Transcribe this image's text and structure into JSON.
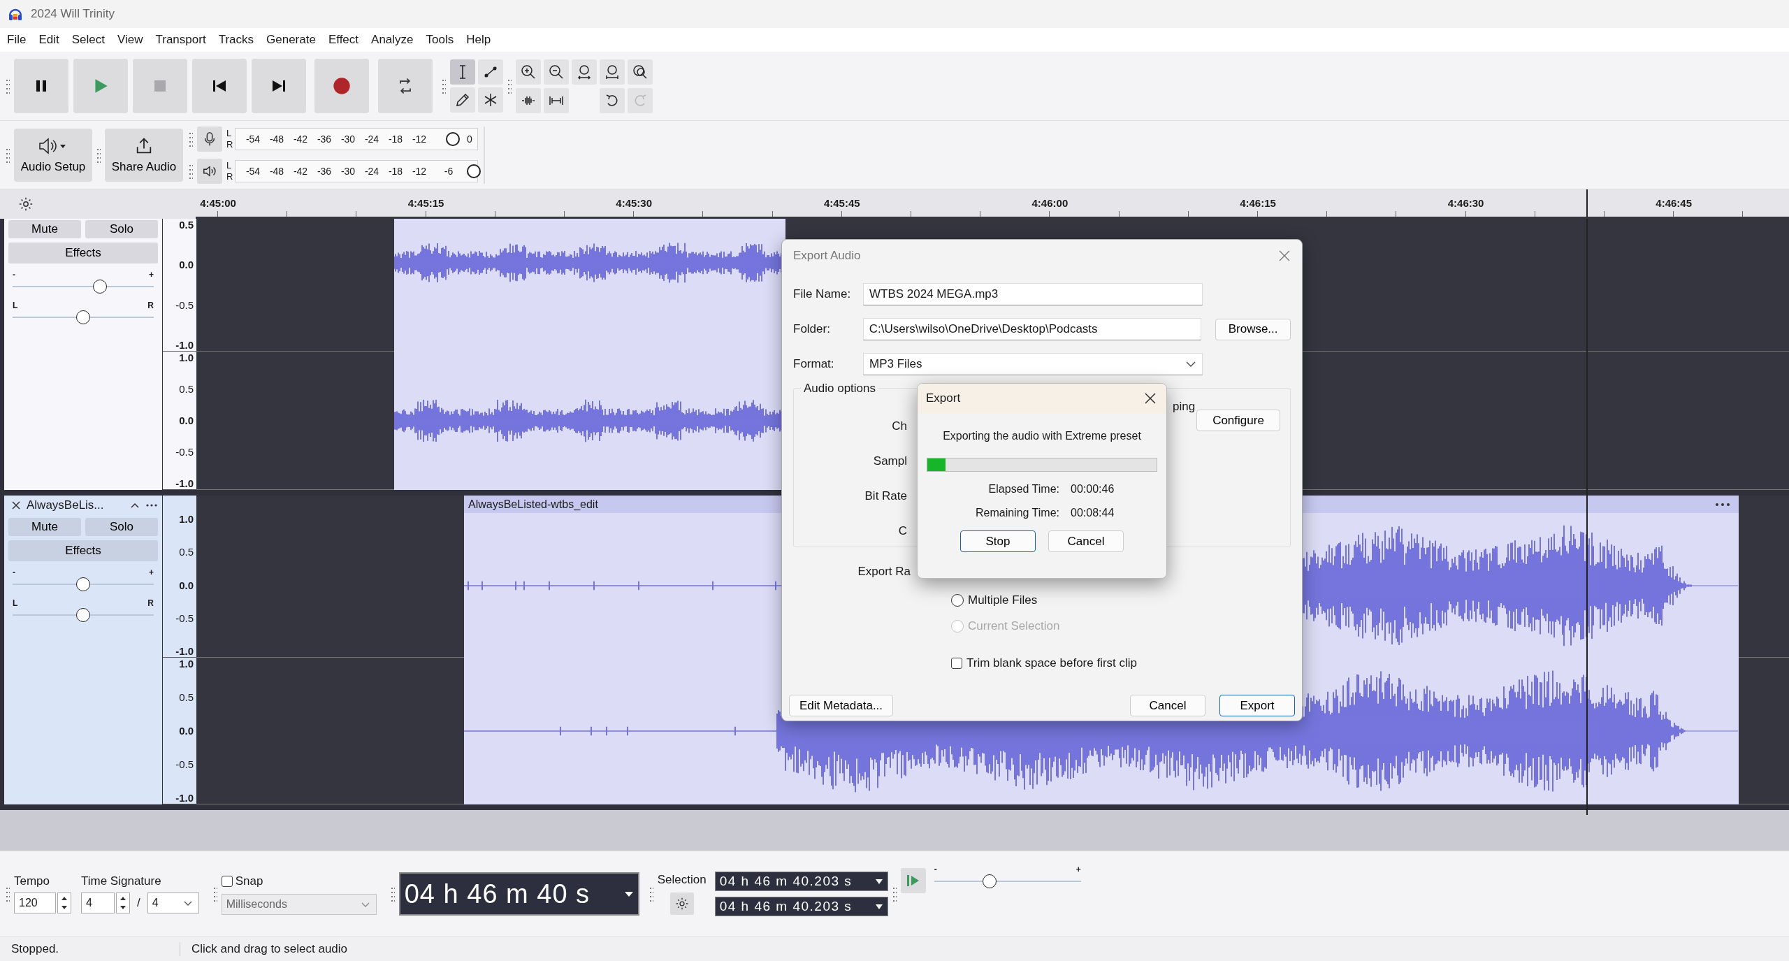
{
  "window": {
    "title": "2024 Will Trinity"
  },
  "menu": [
    "File",
    "Edit",
    "Select",
    "View",
    "Transport",
    "Tracks",
    "Generate",
    "Effect",
    "Analyze",
    "Tools",
    "Help"
  ],
  "tools": [
    {
      "kind": "select",
      "selected": true
    },
    {
      "kind": "envelope",
      "selected": false
    },
    {
      "kind": "draw",
      "selected": false
    },
    {
      "kind": "multi",
      "selected": false
    }
  ],
  "toolbar": {
    "audio_setup": "Audio Setup",
    "share_audio": "Share Audio"
  },
  "meters": [
    {
      "kind": "record",
      "channels": [
        "L",
        "R"
      ],
      "ticks": [
        "-54",
        "-48",
        "-42",
        "-36",
        "-30",
        "-24",
        "-18",
        "-12",
        "0"
      ],
      "level": 0.9
    },
    {
      "kind": "playback",
      "channels": [
        "L",
        "R"
      ],
      "ticks": [
        "-54",
        "-48",
        "-42",
        "-36",
        "-30",
        "-24",
        "-18",
        "-12",
        "-6"
      ],
      "level": 0.985
    }
  ],
  "ruler": {
    "labels": [
      "4:45:00",
      "4:45:15",
      "4:45:30",
      "4:45:45",
      "4:46:00",
      "4:46:15",
      "4:46:30",
      "4:46:45"
    ]
  },
  "tracks": [
    {
      "selected": false,
      "buttons": [
        "Mute",
        "Solo"
      ],
      "effects": "Effects",
      "gain": {
        "marks": [
          "-",
          "+"
        ],
        "level": 0.62
      },
      "pan": {
        "marks": [
          "L",
          "R"
        ],
        "level": 0.5
      },
      "channels": [
        {
          "scale": [
            "0.5",
            "0.0",
            "-0.5",
            "-1.0"
          ]
        },
        {
          "scale": [
            "1.0",
            "0.5",
            "0.0",
            "-0.5",
            "-1.0"
          ]
        }
      ]
    },
    {
      "name": "AlwaysBeLis...",
      "selected": true,
      "clip": {
        "title": "AlwaysBeListed-wtbs_edit"
      },
      "buttons": [
        "Mute",
        "Solo"
      ],
      "effects": "Effects",
      "gain": {
        "marks": [
          "-",
          "+"
        ],
        "level": 0.5
      },
      "pan": {
        "marks": [
          "L",
          "R"
        ],
        "level": 0.5
      },
      "channels": [
        {
          "scale": [
            "1.0",
            "0.5",
            "0.0",
            "-0.5",
            "-1.0"
          ]
        },
        {
          "scale": [
            "1.0",
            "0.5",
            "0.0",
            "-0.5",
            "-1.0"
          ]
        }
      ]
    }
  ],
  "export_audio": {
    "title": "Export Audio",
    "file_name": {
      "label": "File Name:",
      "value": "WTBS 2024 MEGA.mp3"
    },
    "folder": {
      "label": "Folder:",
      "value": "C:\\Users\\wilso\\OneDrive\\Desktop\\Podcasts"
    },
    "browse": "Browse...",
    "format": {
      "label": "Format:",
      "value": "MP3 Files"
    },
    "audio_options": {
      "title": "Audio options",
      "labels": [
        "Ch",
        "Sampl",
        "Bit Rate",
        "C"
      ],
      "trailing_label": "ping",
      "configure": "Configure"
    },
    "export_range": {
      "label": "Export Ra",
      "options": [
        {
          "label": "Multiple Files",
          "selected": false,
          "disabled": false
        },
        {
          "label": "Current Selection",
          "selected": false,
          "disabled": true
        }
      ]
    },
    "trim": {
      "label": "Trim blank space before first clip",
      "checked": false
    },
    "buttons": [
      {
        "label": "Edit Metadata...",
        "default": false
      },
      {
        "label": "Cancel",
        "default": false
      },
      {
        "label": "Export",
        "default": true
      }
    ]
  },
  "progress": {
    "title": "Export",
    "message": "Exporting the audio with Extreme preset",
    "level": 0.08,
    "rows": [
      {
        "label": "Elapsed Time:",
        "value": "00:00:46"
      },
      {
        "label": "Remaining Time:",
        "value": "00:08:44"
      }
    ],
    "buttons": [
      {
        "label": "Stop",
        "default": true
      },
      {
        "label": "Cancel",
        "default": false
      }
    ]
  },
  "bottom": {
    "tempo": {
      "label": "Tempo",
      "value": "120"
    },
    "time_signature": {
      "label": "Time Signature",
      "upper": "4",
      "separator": "/",
      "lower": "4"
    },
    "snap": {
      "label": "Snap",
      "checked": false,
      "unit": "Milliseconds",
      "disabled": true
    },
    "time": "04 h 46 m 40 s",
    "selection": {
      "label": "Selection",
      "start": "04 h 46 m 40.203 s",
      "end": "04 h 46 m 40.203 s"
    },
    "play_speed": {
      "marks": [
        "-",
        "+"
      ],
      "level": 0.38
    }
  },
  "status_bar": [
    "Stopped.",
    "Click and drag to select audio"
  ]
}
